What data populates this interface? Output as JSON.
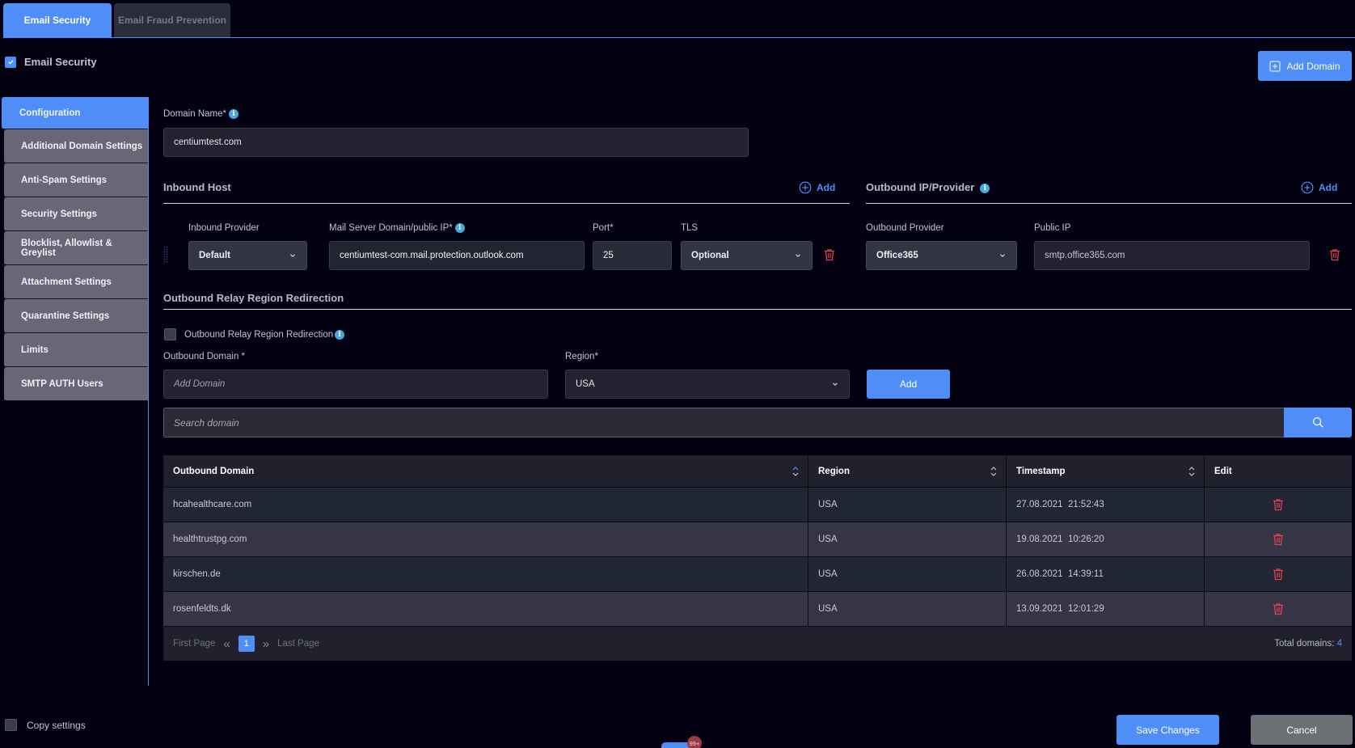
{
  "top_tabs": [
    {
      "label": "Email Security",
      "active": true
    },
    {
      "label": "Email Fraud Prevention",
      "active": false
    }
  ],
  "email_security_toggle": {
    "label": "Email Security",
    "checked": true
  },
  "add_domain_button": {
    "label": "Add Domain",
    "icon": "plus-square-icon"
  },
  "sidebar": {
    "items": [
      {
        "label": "Configuration",
        "active": true
      },
      {
        "label": "Additional Domain Settings",
        "active": false
      },
      {
        "label": "Anti-Spam Settings",
        "active": false
      },
      {
        "label": "Security Settings",
        "active": false
      },
      {
        "label": "Blocklist, Allowlist & Greylist",
        "active": false
      },
      {
        "label": "Attachment Settings",
        "active": false
      },
      {
        "label": "Quarantine Settings",
        "active": false
      },
      {
        "label": "Limits",
        "active": false
      },
      {
        "label": "SMTP AUTH Users",
        "active": false
      }
    ]
  },
  "domain_name": {
    "label": "Domain Name*",
    "value": "centiumtest.com"
  },
  "inbound_host": {
    "title": "Inbound Host",
    "add_label": "Add",
    "provider_label": "Inbound Provider",
    "provider_value": "Default",
    "mail_server_label": "Mail Server Domain/public IP*",
    "mail_server_value": "centiumtest-com.mail.protection.outlook.com",
    "port_label": "Port*",
    "port_value": "25",
    "tls_label": "TLS",
    "tls_value": "Optional"
  },
  "outbound_ip": {
    "title": "Outbound IP/Provider",
    "add_label": "Add",
    "provider_label": "Outbound Provider",
    "provider_value": "Office365",
    "public_ip_label": "Public IP",
    "public_ip_value": "smtp.office365.com"
  },
  "relay": {
    "title": "Outbound Relay Region Redirection",
    "checkbox_label": "Outbound Relay Region Redirection",
    "checkbox_checked": false,
    "domain_label": "Outbound Domain *",
    "domain_placeholder": "Add Domain",
    "region_label": "Region*",
    "region_value": "USA",
    "add_button": "Add"
  },
  "search": {
    "placeholder": "Search domain",
    "icon": "search-icon"
  },
  "table": {
    "columns": [
      "Outbound Domain",
      "Region",
      "Timestamp",
      "Edit"
    ],
    "rows": [
      {
        "domain": "hcahealthcare.com",
        "region": "USA",
        "timestamp": "27.08.2021  21:52:43"
      },
      {
        "domain": "healthtrustpg.com",
        "region": "USA",
        "timestamp": "19.08.2021  10:26:20"
      },
      {
        "domain": "kirschen.de",
        "region": "USA",
        "timestamp": "26.08.2021  14:39:11"
      },
      {
        "domain": "rosenfeldts.dk",
        "region": "USA",
        "timestamp": "13.09.2021  12:01:29"
      }
    ]
  },
  "pagination": {
    "first_label": "First Page",
    "last_label": "Last Page",
    "current_page": "1",
    "total_label": "Total domains:",
    "total_value": "4"
  },
  "footer": {
    "copy_settings_label": "Copy settings",
    "copy_settings_checked": false,
    "save_label": "Save Changes",
    "cancel_label": "Cancel",
    "chat_badge": "99+"
  },
  "colors": {
    "accent": "#4f8ef7",
    "background": "#020213",
    "danger": "#e0434f",
    "info": "#4aa8e0"
  }
}
